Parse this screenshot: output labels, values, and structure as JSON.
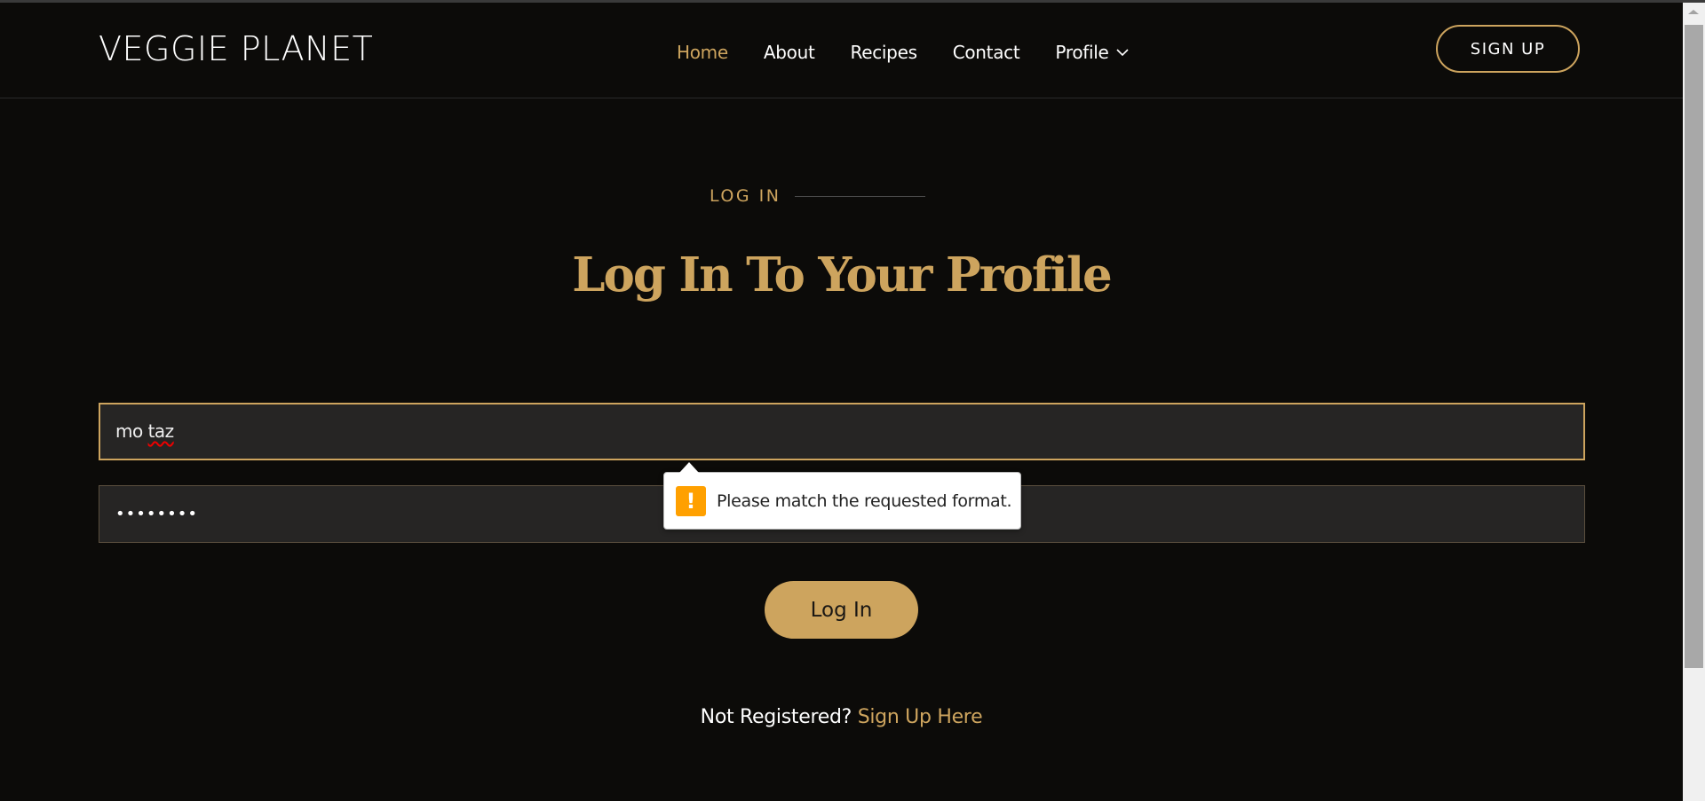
{
  "header": {
    "logo": "VEGGIE PLANET",
    "nav": [
      {
        "label": "Home",
        "active": true
      },
      {
        "label": "About",
        "active": false
      },
      {
        "label": "Recipes",
        "active": false
      },
      {
        "label": "Contact",
        "active": false
      },
      {
        "label": "Profile",
        "active": false,
        "icon": "chevron-down-icon"
      }
    ],
    "signup_label": "SIGN UP"
  },
  "section": {
    "tag": "LOG IN",
    "title": "Log In To Your Profile"
  },
  "form": {
    "username_value": "mo taz",
    "username_plain": "mo ",
    "username_misspelled": "taz",
    "password_value": "••••••••",
    "submit_label": "Log In"
  },
  "validation": {
    "icon": "warning-icon",
    "icon_glyph": "!",
    "message": "Please match the requested format."
  },
  "register": {
    "question": "Not Registered?",
    "link_label": "Sign Up Here"
  },
  "colors": {
    "accent": "#cda45e",
    "background": "#0c0b09",
    "input_bg": "#262524",
    "warning": "#ffa000"
  }
}
